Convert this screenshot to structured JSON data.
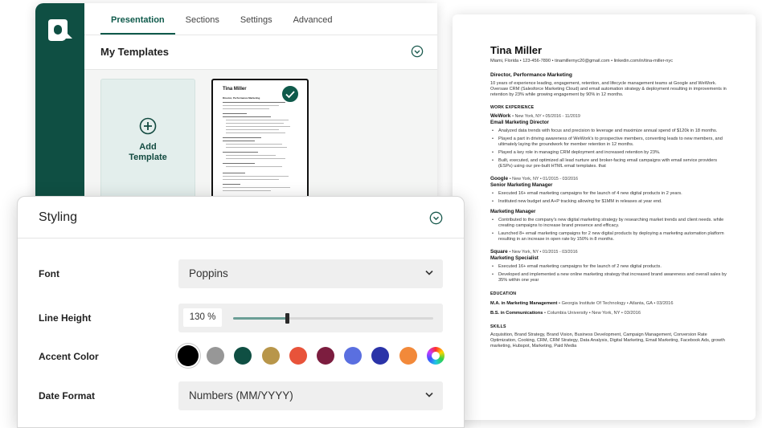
{
  "builder": {
    "tabs": [
      "Presentation",
      "Sections",
      "Settings",
      "Advanced"
    ],
    "active_tab": "Presentation",
    "templates_title": "My Templates",
    "add_template_label": "Add\nTemplate"
  },
  "resume": {
    "name": "Tina Miller",
    "contact": "Miami, Florida • 123-456-7890 • tinamillernyc20@gmail.com • linkedin.com/in/tina-miller-nyc",
    "headline": "Director, Performance Marketing",
    "summary": "10 years of experience leading, engagement, retention, and lifecycle management teams at Google and WeWork. Oversaw CRM (Salesforce Marketing Cloud) and email automation strategy & deployment resulting in improvements in retention by 23% while growing engagement by 90% in 12 months.",
    "work_title": "WORK EXPERIENCE",
    "jobs": [
      {
        "company": "WeWork",
        "meta": "• New York, NY • 05/2016 - 11/2019",
        "roles": [
          {
            "title": "Email Marketing Director",
            "bullets": [
              "Analyzed data trends with focus and precision to leverage and maximize annual spend of $120k in 18 months.",
              "Played a part in driving awareness of WeWork's to prospective members, converting leads to new members, and ultimately laying the groundwork for member retention in 12 months.",
              "Played a key role in managing CRM deployment and increased retention by 23%.",
              "Built, executed, and optimized all lead nurture and broker-facing email campaigns with email service providers (ESPs) using our pre-built HTML email templates. that"
            ]
          }
        ]
      },
      {
        "company": "Google",
        "meta": "• New York, NY • 01/2015 - 03/2016",
        "roles": [
          {
            "title": "Senior Marketing Manager",
            "bullets": [
              "Executed 16+ email marketing campaigns for the launch of 4 new digital products in 2 years.",
              "Instituted new budget and A+P tracking allowing for $1MM in releases at year end."
            ]
          },
          {
            "title": "Marketing Manager",
            "bullets": [
              "Contributed to the company's new digital marketing strategy by researching market trends and client needs. while creating campaigns to increase brand presence and efficacy.",
              "Launched 8+ email marketing campaigns for 2 new digital products by deploying a marketing automation platform resulting in an increase in open rate by 150% in 8 months."
            ]
          }
        ]
      },
      {
        "company": "Square",
        "meta": "• New York, NY • 01/2015 - 03/2016",
        "roles": [
          {
            "title": "Marketing Specialist",
            "bullets": [
              "Executed 16+ email marketing campaigns for the launch of 2 new digital products.",
              "Developed and implemented a new online marketing strategy that increased brand awareness and overall sales by 35% within one year"
            ]
          }
        ]
      }
    ],
    "education_title": "EDUCATION",
    "education": [
      {
        "degree": "M.A. in Marketing Management",
        "meta": "• Georgia Institute Of Technology • Atlanta, GA • 03/2016"
      },
      {
        "degree": "B.S. in Communications",
        "meta": "• Columbia University • New York, NY • 03/2016"
      }
    ],
    "skills_title": "SKILLS",
    "skills": "Acquisition, Brand Strategy, Brand Vision, Business Development, Campaign Management, Conversion Rate Optimization, Cooking, CRM, CRM Strategy, Data Analysis, Digital Marketing, Email Marketing, Facebook Ads, growth marketing, Hubspot, Marketing, Paid Media"
  },
  "template_thumb": {
    "name": "Tina Miller",
    "headline": "Director, Performance Marketing"
  },
  "styling": {
    "title": "Styling",
    "font_label": "Font",
    "font_value": "Poppins",
    "line_height_label": "Line Height",
    "line_height_value": "130 %",
    "line_height_level": 0.27,
    "accent_label": "Accent Color",
    "accent_colors": [
      "#000000",
      "#979797",
      "#0f4f43",
      "#b8964a",
      "#e8533a",
      "#7c1d3f",
      "#5a6fe0",
      "#2a33a8",
      "#f2893a",
      "rainbow"
    ],
    "accent_selected": 0,
    "date_format_label": "Date Format",
    "date_format_value": "Numbers (MM/YYYY)"
  },
  "colors": {
    "brand": "#0f4f43",
    "accent_text": "#0f5a4b"
  }
}
